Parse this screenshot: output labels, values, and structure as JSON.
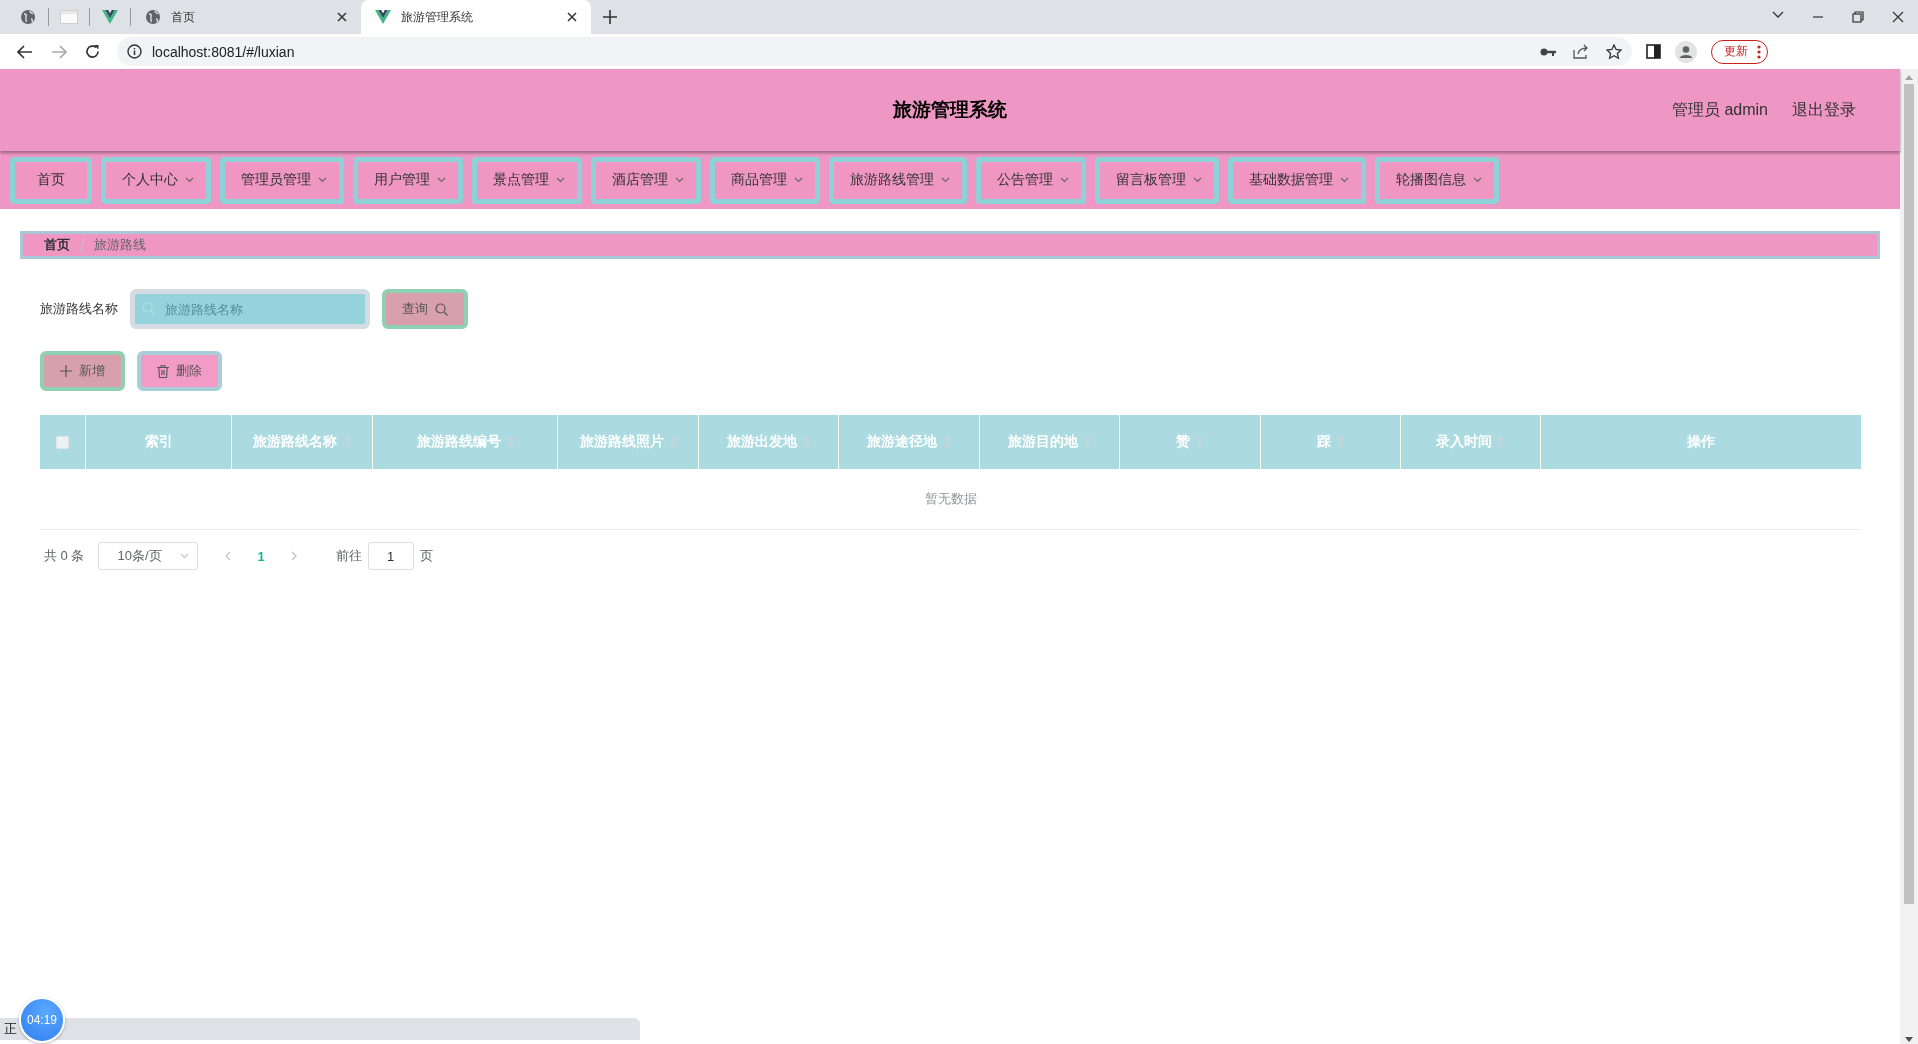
{
  "browser": {
    "tabs": [
      {
        "kind": "globe",
        "selected": false
      },
      {
        "kind": "blank",
        "selected": false
      },
      {
        "kind": "vue",
        "selected": false
      },
      {
        "kind": "globe",
        "title": "首页",
        "selected": false
      },
      {
        "kind": "vue",
        "title": "旅游管理系统",
        "selected": true
      }
    ],
    "url": "localhost:8081/#/luxian",
    "update_button": "更新"
  },
  "header": {
    "title": "旅游管理系统",
    "user": "管理员 admin",
    "logout": "退出登录"
  },
  "nav": [
    {
      "label": "首页",
      "dropdown": false
    },
    {
      "label": "个人中心",
      "dropdown": true
    },
    {
      "label": "管理员管理",
      "dropdown": true
    },
    {
      "label": "用户管理",
      "dropdown": true
    },
    {
      "label": "景点管理",
      "dropdown": true
    },
    {
      "label": "酒店管理",
      "dropdown": true
    },
    {
      "label": "商品管理",
      "dropdown": true
    },
    {
      "label": "旅游路线管理",
      "dropdown": true
    },
    {
      "label": "公告管理",
      "dropdown": true
    },
    {
      "label": "留言板管理",
      "dropdown": true
    },
    {
      "label": "基础数据管理",
      "dropdown": true
    },
    {
      "label": "轮播图信息",
      "dropdown": true
    }
  ],
  "breadcrumb": [
    {
      "label": "首页",
      "selected": false
    },
    {
      "label": "旅游路线",
      "selected": true
    }
  ],
  "search": {
    "label": "旅游路线名称",
    "placeholder": "旅游路线名称",
    "button": "查询"
  },
  "actions": [
    {
      "kind": "add",
      "label": "新增"
    },
    {
      "kind": "delete",
      "label": "删除"
    }
  ],
  "table": {
    "select_all_checked": false,
    "columns": [
      {
        "label": "索引",
        "sortable": false
      },
      {
        "label": "旅游路线名称",
        "sortable": true
      },
      {
        "label": "旅游路线编号",
        "sortable": true
      },
      {
        "label": "旅游路线照片",
        "sortable": true
      },
      {
        "label": "旅游出发地",
        "sortable": true
      },
      {
        "label": "旅游途径地",
        "sortable": true
      },
      {
        "label": "旅游目的地",
        "sortable": true
      },
      {
        "label": "赞",
        "sortable": true
      },
      {
        "label": "踩",
        "sortable": true
      },
      {
        "label": "录入时间",
        "sortable": true
      },
      {
        "label": "操作",
        "sortable": false
      }
    ],
    "empty_text": "暂无数据"
  },
  "pagination": {
    "total": "共 0 条",
    "page_size": "10条/页",
    "pages": [
      {
        "label": "1",
        "selected": true
      }
    ],
    "goto_label": "前往",
    "goto_value": "1",
    "page_unit": "页"
  },
  "status_bar": {
    "text": "正",
    "timer": "04:19"
  }
}
